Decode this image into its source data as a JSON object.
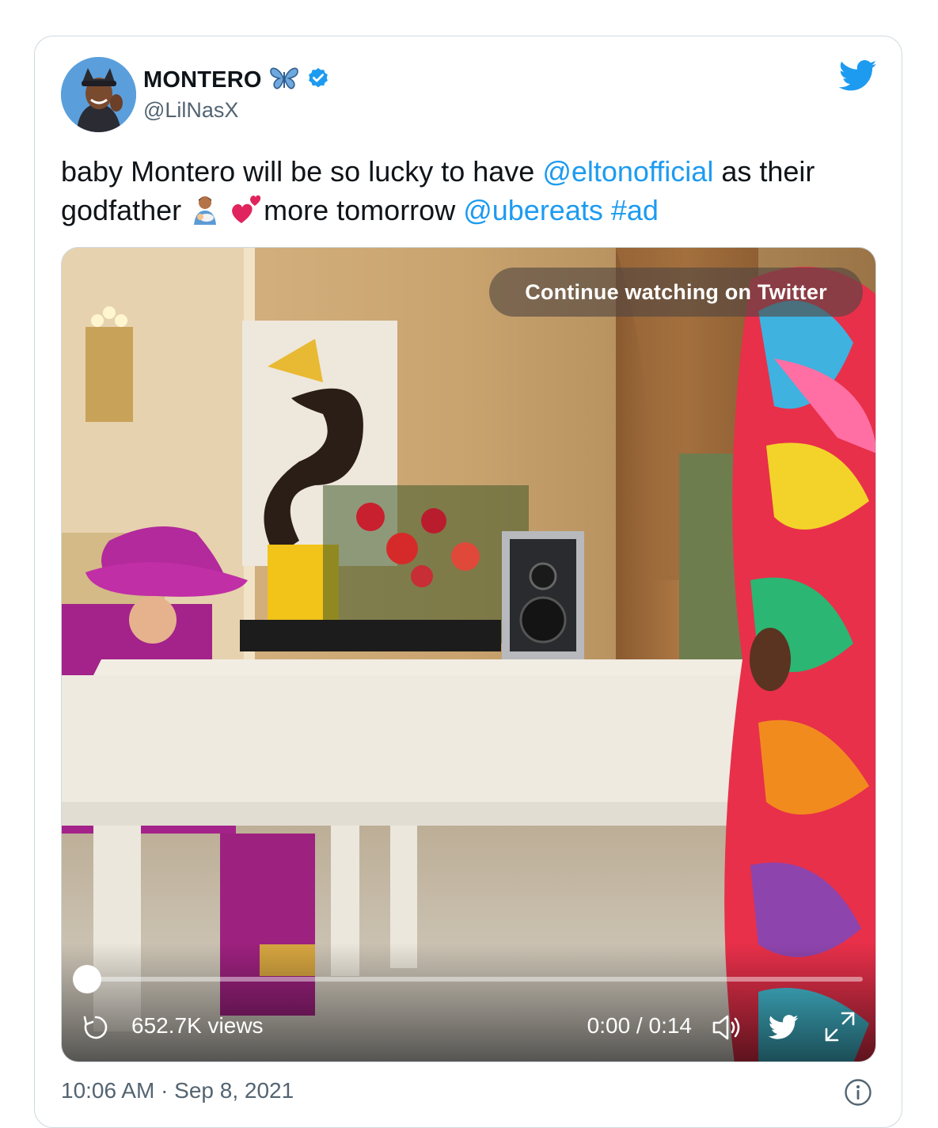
{
  "tweet": {
    "display_name": "MONTERO",
    "name_emoji": "🦋",
    "handle": "@LilNasX",
    "text": {
      "part1": "baby Montero will be so lucky to have ",
      "mention1": "@eltonofficial",
      "part2": " as their godfather ",
      "part3": "more tomorrow ",
      "mention2": "@ubereats",
      "hashtag": "#ad"
    },
    "timestamp": "10:06 AM · Sep 8, 2021"
  },
  "video": {
    "continue_label": "Continue watching on Twitter",
    "views": "652.7K views",
    "time": "0:00 / 0:14",
    "progress": 0
  },
  "colors": {
    "link": "#1d9bf0",
    "verified": "#1d9bf0",
    "secondary_text": "#536471",
    "border": "#cfd9de"
  },
  "icons": [
    "avatar",
    "butterfly-icon",
    "verified-badge-icon",
    "twitter-bird-icon",
    "replay-icon",
    "volume-icon",
    "expand-icon",
    "info-icon"
  ]
}
